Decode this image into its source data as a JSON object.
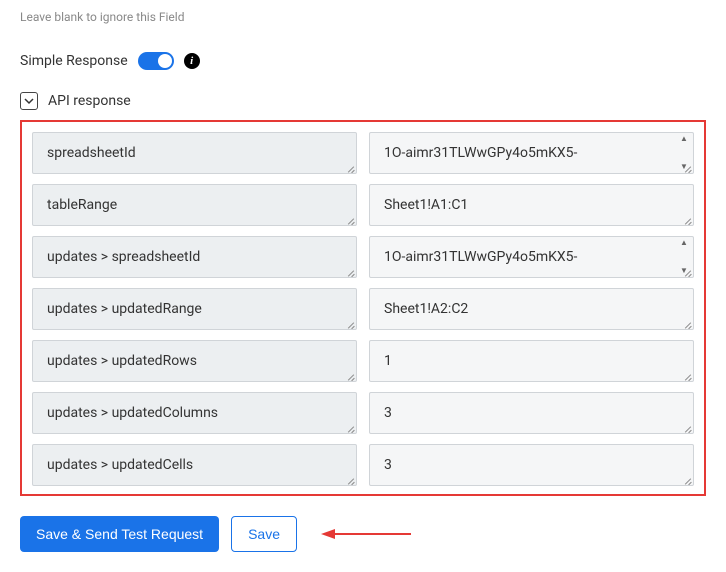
{
  "hint": "Leave blank to ignore this Field",
  "simpleResponse": {
    "label": "Simple Response",
    "enabled": true
  },
  "apiResponse": {
    "label": "API response",
    "rows": [
      {
        "key": "spreadsheetId",
        "value": "1O-aimr31TLWwGPy4o5mKX5-",
        "hasScroll": true
      },
      {
        "key": "tableRange",
        "value": "Sheet1!A1:C1",
        "hasScroll": false
      },
      {
        "key": "updates > spreadsheetId",
        "value": "1O-aimr31TLWwGPy4o5mKX5-",
        "hasScroll": true
      },
      {
        "key": "updates > updatedRange",
        "value": "Sheet1!A2:C2",
        "hasScroll": false
      },
      {
        "key": "updates > updatedRows",
        "value": "1",
        "hasScroll": false
      },
      {
        "key": "updates > updatedColumns",
        "value": "3",
        "hasScroll": false
      },
      {
        "key": "updates > updatedCells",
        "value": "3",
        "hasScroll": false
      }
    ]
  },
  "buttons": {
    "saveSend": "Save & Send Test Request",
    "save": "Save"
  },
  "colors": {
    "primary": "#1a73e8",
    "annotation": "#e53935"
  }
}
